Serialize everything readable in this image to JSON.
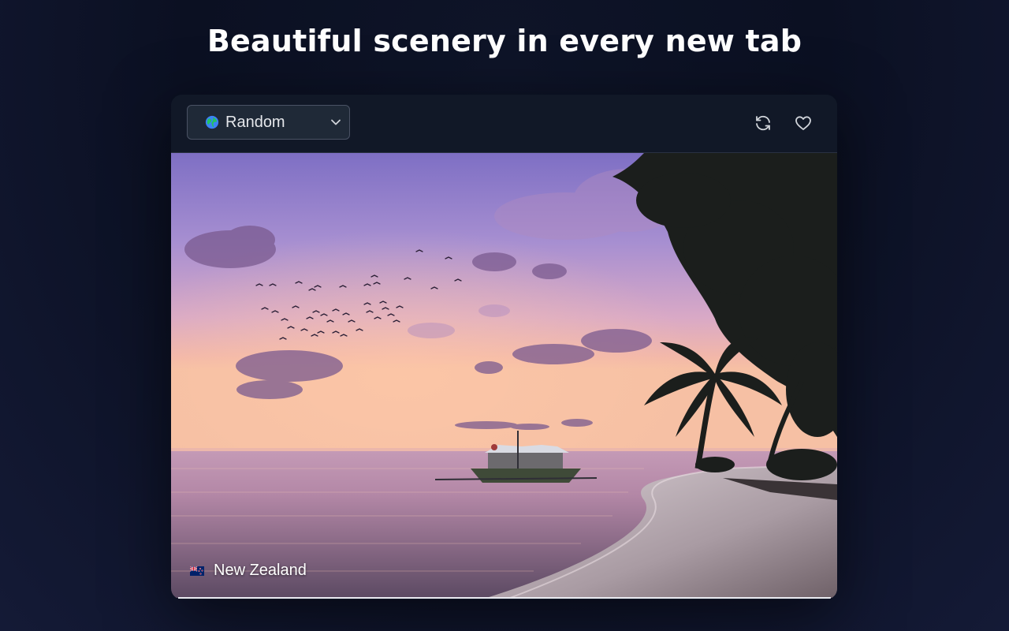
{
  "headline": "Beautiful scenery in every new tab",
  "toolbar": {
    "category_select": {
      "selected": "Random",
      "icon": "globe-icon"
    },
    "refresh_icon": "refresh-icon",
    "favorite_icon": "heart-icon"
  },
  "photo": {
    "location": "New Zealand",
    "flag_icon": "new-zealand-flag-icon"
  },
  "colors": {
    "background": "#0b1022",
    "card": "#111827",
    "select_bg": "#1f2937",
    "text": "#ffffff"
  }
}
